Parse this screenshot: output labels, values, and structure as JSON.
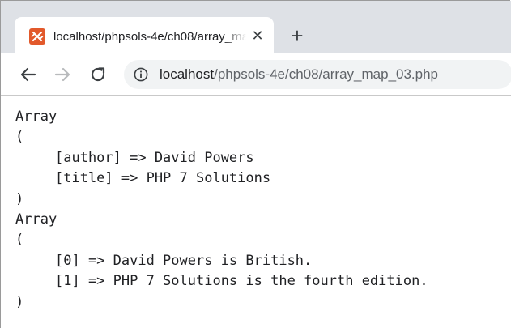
{
  "tab": {
    "title": "localhost/phpsols-4e/ch08/array_map_03.php",
    "favicon": "xampp-favicon-icon",
    "close_glyph": "✕"
  },
  "new_tab_glyph": "+",
  "address_bar": {
    "host": "localhost",
    "path": "/phpsols-4e/ch08/array_map_03.php"
  },
  "output": {
    "line1": "Array",
    "line2": "(",
    "line3": "[author] => David Powers",
    "line4": "[title] => PHP 7 Solutions",
    "line5": ")",
    "line6": "Array",
    "line7": "(",
    "line8": "[0] => David Powers is British.",
    "line9": "[1] => PHP 7 Solutions is the fourth edition.",
    "line10": ")"
  },
  "colors": {
    "tabstrip": "#dee1e6",
    "omnibox": "#f1f3f4",
    "favicon": "#e2592b"
  }
}
